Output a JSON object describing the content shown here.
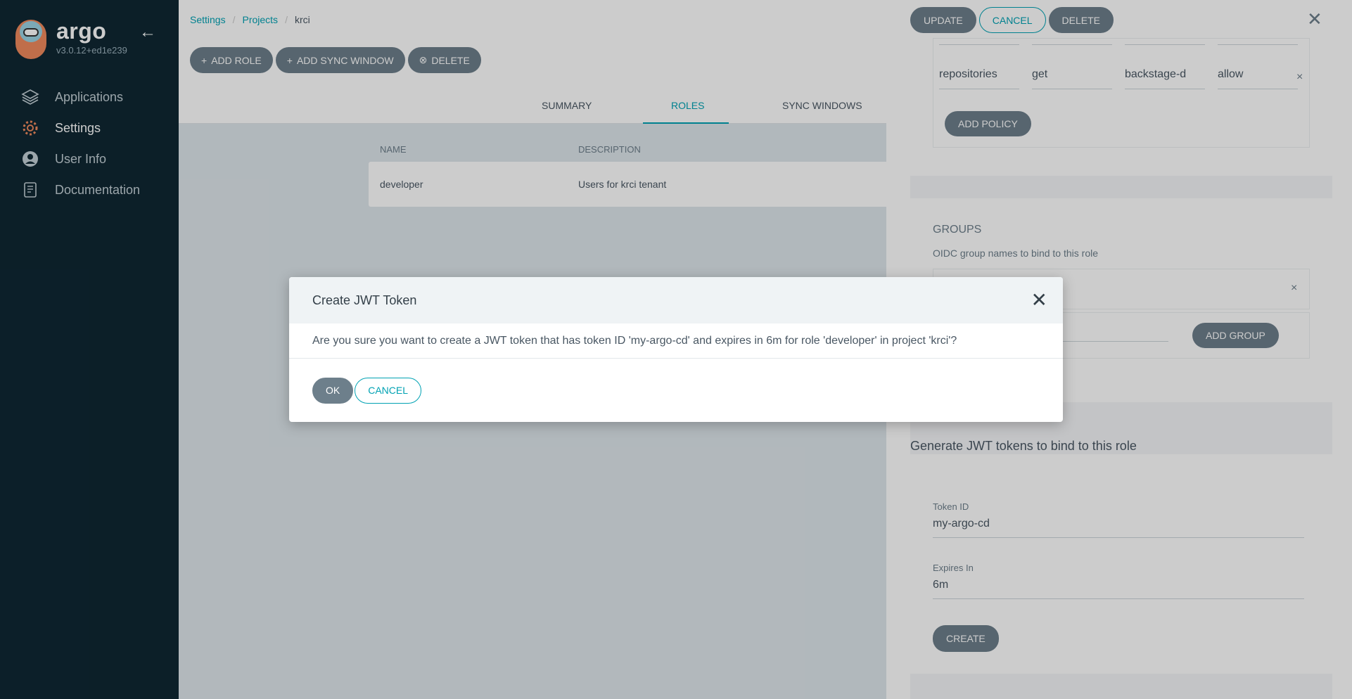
{
  "sidebar": {
    "logo_name": "argo",
    "version": "v3.0.12+ed1e239",
    "collapse_icon": "arrow-left-icon",
    "items": [
      {
        "label": "Applications",
        "icon": "layers-icon"
      },
      {
        "label": "Settings",
        "icon": "gear-icon"
      },
      {
        "label": "User Info",
        "icon": "user-circle-icon"
      },
      {
        "label": "Documentation",
        "icon": "book-icon"
      }
    ]
  },
  "breadcrumb": {
    "items": [
      "Settings",
      "Projects",
      "krci"
    ],
    "separator": "/"
  },
  "toolbar": {
    "add_role": "ADD ROLE",
    "add_sync_window": "ADD SYNC WINDOW",
    "delete": "DELETE"
  },
  "tabs": [
    "SUMMARY",
    "ROLES",
    "SYNC WINDOWS"
  ],
  "roles_table": {
    "headers": [
      "NAME",
      "DESCRIPTION"
    ],
    "rows": [
      {
        "name": "developer",
        "description": "Users for krci tenant"
      }
    ]
  },
  "panel": {
    "update": "UPDATE",
    "cancel": "CANCEL",
    "delete": "DELETE",
    "policy_row": [
      "repositories",
      "get",
      "backstage-d",
      "allow"
    ],
    "remove_symbol": "×",
    "add_policy": "ADD POLICY",
    "groups_title": "GROUPS",
    "groups_subtitle": "OIDC group names to bind to this role",
    "add_group": "ADD GROUP",
    "jwt_title": "Generate JWT tokens to bind to this role",
    "token_id_label": "Token ID",
    "token_id_value": "my-argo-cd",
    "expires_label": "Expires In",
    "expires_value": "6m",
    "create": "CREATE"
  },
  "modal": {
    "title": "Create JWT Token",
    "message": "Are you sure you want to create a JWT token that has token ID 'my-argo-cd' and expires in 6m for role 'developer' in project 'krci'?",
    "ok": "OK",
    "cancel": "CANCEL"
  },
  "colors": {
    "sidebar_bg": "#0f2733",
    "accent": "#00a2b3",
    "button": "#6d7f8b"
  }
}
